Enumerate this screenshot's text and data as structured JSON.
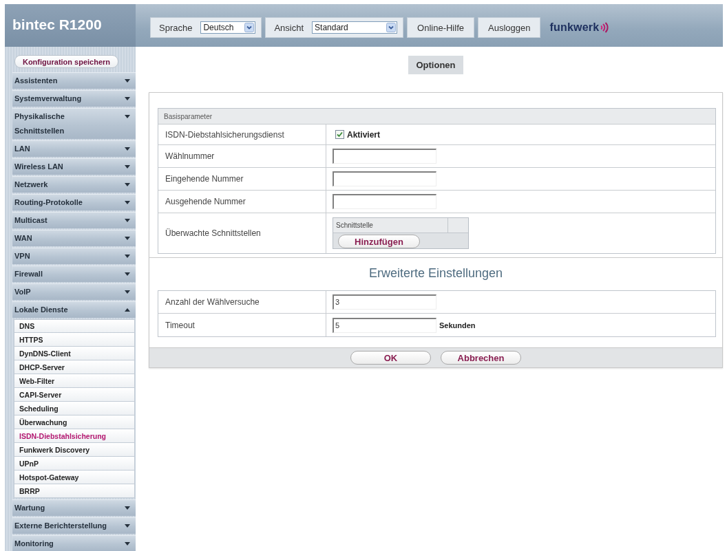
{
  "header": {
    "title": "bintec R1200",
    "language": {
      "label": "Sprache",
      "value": "Deutsch"
    },
    "view": {
      "label": "Ansicht",
      "value": "Standard"
    },
    "links": [
      "Online-Hilfe",
      "Ausloggen"
    ],
    "logo": "funkwerk"
  },
  "sidebar": {
    "save_button": "Konfiguration speichern",
    "items": [
      {
        "label": "Assistenten",
        "expanded": false
      },
      {
        "label": "Systemverwaltung",
        "expanded": false
      },
      {
        "label": "Physikalische Schnittstellen",
        "expanded": false
      },
      {
        "label": "LAN",
        "expanded": false
      },
      {
        "label": "Wireless LAN",
        "expanded": false
      },
      {
        "label": "Netzwerk",
        "expanded": false
      },
      {
        "label": "Routing-Protokolle",
        "expanded": false
      },
      {
        "label": "Multicast",
        "expanded": false
      },
      {
        "label": "WAN",
        "expanded": false
      },
      {
        "label": "VPN",
        "expanded": false
      },
      {
        "label": "Firewall",
        "expanded": false
      },
      {
        "label": "VoIP",
        "expanded": false
      },
      {
        "label": "Lokale Dienste",
        "expanded": true,
        "children": [
          {
            "label": "DNS",
            "selected": false
          },
          {
            "label": "HTTPS",
            "selected": false
          },
          {
            "label": "DynDNS-Client",
            "selected": false
          },
          {
            "label": "DHCP-Server",
            "selected": false
          },
          {
            "label": "Web-Filter",
            "selected": false
          },
          {
            "label": "CAPI-Server",
            "selected": false
          },
          {
            "label": "Scheduling",
            "selected": false
          },
          {
            "label": "Überwachung",
            "selected": false
          },
          {
            "label": "ISDN-Diebstahlsicherung",
            "selected": true
          },
          {
            "label": "Funkwerk Discovery",
            "selected": false
          },
          {
            "label": "UPnP",
            "selected": false
          },
          {
            "label": "Hotspot-Gateway",
            "selected": false
          },
          {
            "label": "BRRP",
            "selected": false
          }
        ]
      },
      {
        "label": "Wartung",
        "expanded": false
      },
      {
        "label": "Externe Berichterstellung",
        "expanded": false
      },
      {
        "label": "Monitoring",
        "expanded": false
      }
    ]
  },
  "tabs": [
    {
      "label": "Optionen",
      "selected": true
    }
  ],
  "form": {
    "section": "Basisparameter",
    "rows": [
      {
        "kind": "checkbox",
        "label": "ISDN-Diebstahlsicherungsdienst",
        "checked": true,
        "text": "Aktiviert"
      },
      {
        "kind": "input",
        "label": "Wählnummer"
      },
      {
        "kind": "input",
        "label": "Eingehende Nummer"
      },
      {
        "kind": "input",
        "label": "Ausgehende Nummer"
      },
      {
        "kind": "list",
        "label": "Überwachte Schnittstellen",
        "columns": [
          "Schnittstelle"
        ],
        "button": "Hinzufügen"
      }
    ]
  },
  "advanced": {
    "title": "Erweiterte Einstellungen",
    "rows": [
      {
        "kind": "input",
        "label": "Anzahl der Wählversuche",
        "value": "3"
      },
      {
        "kind": "input",
        "label": "Timeout",
        "value": "5",
        "unit": "Sekunden"
      }
    ]
  },
  "buttons": [
    "OK",
    "Abbrechen"
  ]
}
